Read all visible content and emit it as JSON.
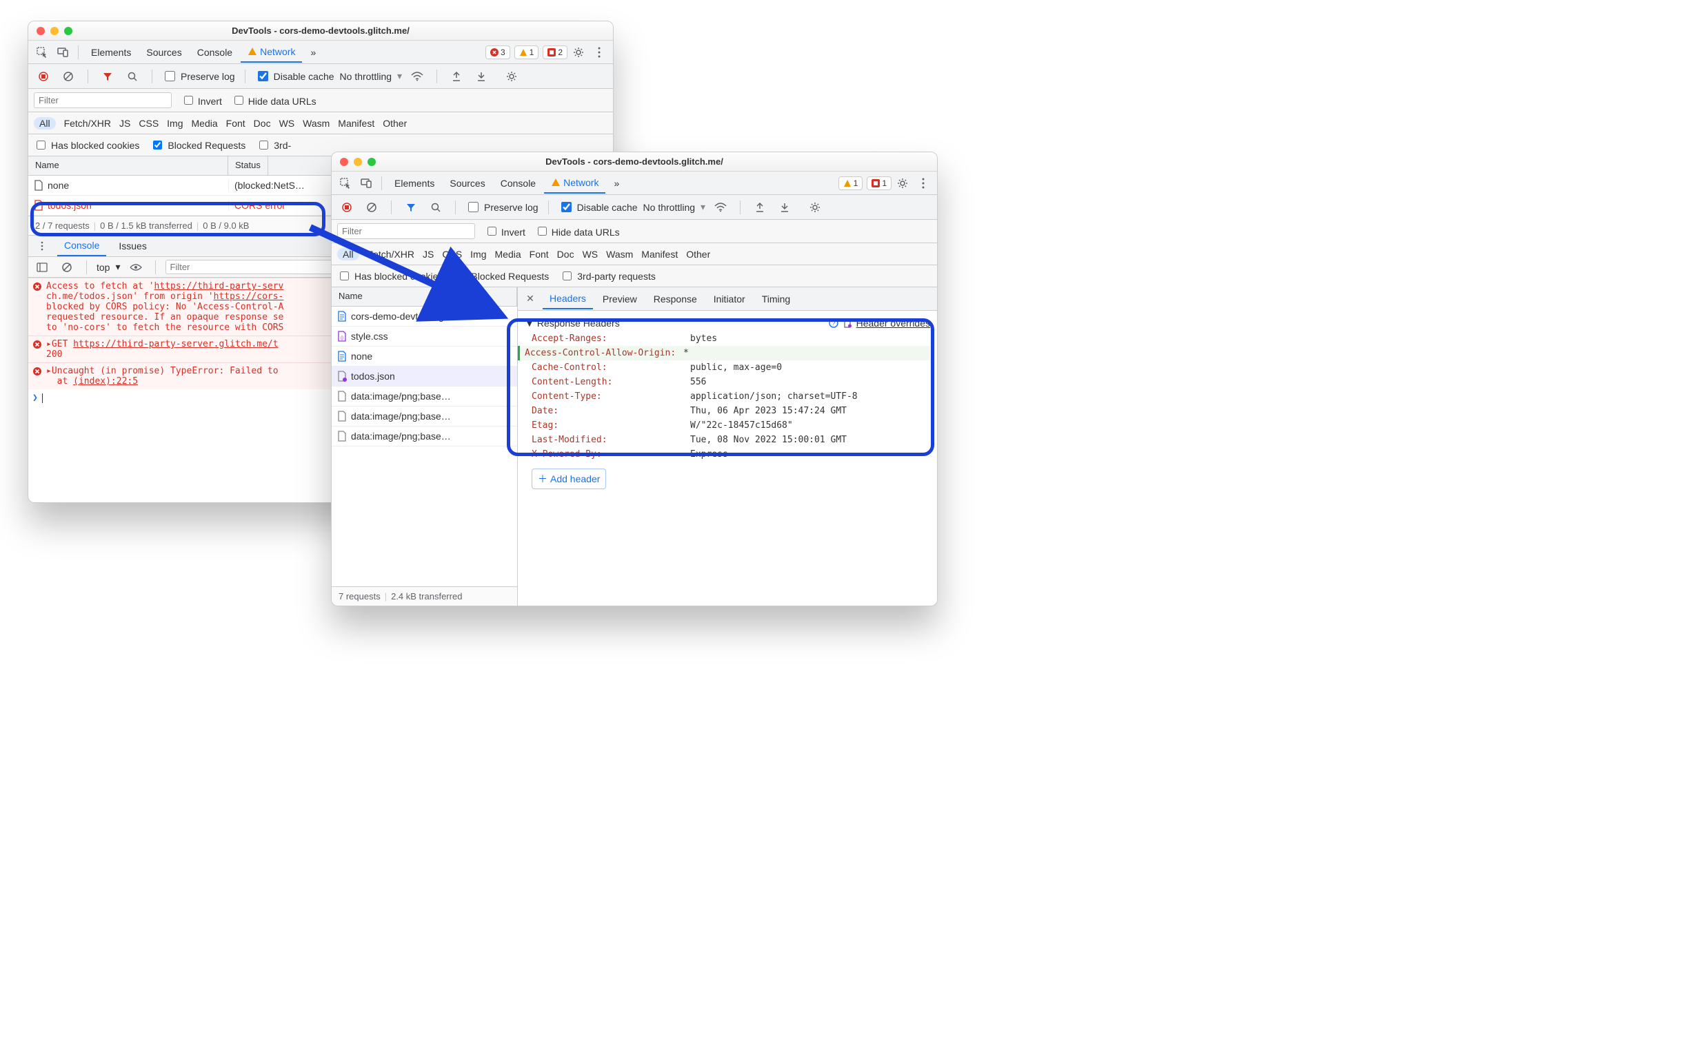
{
  "back": {
    "title": "DevTools - cors-demo-devtools.glitch.me/",
    "toptabs": {
      "elements": "Elements",
      "sources": "Sources",
      "console": "Console",
      "network": "Network",
      "more": "»"
    },
    "badges": {
      "errors": "3",
      "warnings": "1",
      "issues": "2"
    },
    "toolbar": {
      "preserve": "Preserve log",
      "disable": "Disable cache",
      "throttle": "No throttling"
    },
    "filter": {
      "placeholder": "Filter",
      "invert": "Invert",
      "hide": "Hide data URLs"
    },
    "chips": {
      "all": "All",
      "xhr": "Fetch/XHR",
      "js": "JS",
      "css": "CSS",
      "img": "Img",
      "media": "Media",
      "font": "Font",
      "doc": "Doc",
      "ws": "WS",
      "wasm": "Wasm",
      "manifest": "Manifest",
      "other": "Other"
    },
    "opts": {
      "blocked_cookies": "Has blocked cookies",
      "blocked_req": "Blocked Requests",
      "third": "3rd-"
    },
    "cols": {
      "name": "Name",
      "status": "Status"
    },
    "rows": [
      {
        "name": "none",
        "status": "(blocked:NetS…",
        "cls": ""
      },
      {
        "name": "todos.json",
        "status": "CORS error",
        "cls": "err"
      }
    ],
    "footer": {
      "a": "2 / 7 requests",
      "b": "0 B / 1.5 kB transferred",
      "c": "0 B / 9.0 kB"
    },
    "drawer_tabs": {
      "console": "Console",
      "issues": "Issues"
    },
    "context": "top",
    "filter2": "Filter",
    "console": [
      "Access to fetch at 'https://third-party-serv\nch.me/todos.json' from origin 'https://cors-\nblocked by CORS policy: No 'Access-Control-A\nrequested resource. If an opaque response se\nto 'no-cors' to fetch the resource with CORS",
      "▸GET https://third-party-server.glitch.me/t\n200",
      "▸Uncaught (in promise) TypeError: Failed to\n  at (index):22:5"
    ]
  },
  "front": {
    "title": "DevTools - cors-demo-devtools.glitch.me/",
    "toptabs": {
      "elements": "Elements",
      "sources": "Sources",
      "console": "Console",
      "network": "Network",
      "more": "»"
    },
    "badges": {
      "warnings": "1",
      "issues": "1"
    },
    "toolbar": {
      "preserve": "Preserve log",
      "disable": "Disable cache",
      "throttle": "No throttling"
    },
    "filter": {
      "placeholder": "Filter",
      "invert": "Invert",
      "hide": "Hide data URLs"
    },
    "chips": {
      "all": "All",
      "xhr": "Fetch/XHR",
      "js": "JS",
      "css": "CSS",
      "img": "Img",
      "media": "Media",
      "font": "Font",
      "doc": "Doc",
      "ws": "WS",
      "wasm": "Wasm",
      "manifest": "Manifest",
      "other": "Other"
    },
    "opts": {
      "blocked_cookies": "Has blocked cookies",
      "blocked_req": "Blocked Requests",
      "third": "3rd-party requests"
    },
    "cols": {
      "name": "Name"
    },
    "files": [
      {
        "name": "cors-demo-devtools.glitch.me",
        "icon": "doc",
        "color": "#1a73e8"
      },
      {
        "name": "style.css",
        "icon": "css",
        "color": "#9334e6"
      },
      {
        "name": "none",
        "icon": "doc",
        "color": "#1a73e8"
      },
      {
        "name": "todos.json",
        "icon": "file",
        "sel": true,
        "color": "#888"
      },
      {
        "name": "data:image/png;base…",
        "icon": "file",
        "color": "#888"
      },
      {
        "name": "data:image/png;base…",
        "icon": "file",
        "color": "#888"
      },
      {
        "name": "data:image/png;base…",
        "icon": "file",
        "color": "#888"
      }
    ],
    "footer": {
      "a": "7 requests",
      "b": "2.4 kB transferred"
    },
    "detail_tabs": {
      "headers": "Headers",
      "preview": "Preview",
      "response": "Response",
      "initiator": "Initiator",
      "timing": "Timing"
    },
    "section": "Response Headers",
    "override": "Header overrides",
    "headers": [
      {
        "k": "Accept-Ranges:",
        "v": "bytes"
      },
      {
        "k": "Access-Control-Allow-Origin:",
        "v": "*",
        "edited": true
      },
      {
        "k": "Cache-Control:",
        "v": "public, max-age=0"
      },
      {
        "k": "Content-Length:",
        "v": "556"
      },
      {
        "k": "Content-Type:",
        "v": "application/json; charset=UTF-8"
      },
      {
        "k": "Date:",
        "v": "Thu, 06 Apr 2023 15:47:24 GMT"
      },
      {
        "k": "Etag:",
        "v": "W/\"22c-18457c15d68\""
      },
      {
        "k": "Last-Modified:",
        "v": "Tue, 08 Nov 2022 15:00:01 GMT"
      },
      {
        "k": "X-Powered-By:",
        "v": "Express"
      }
    ],
    "addheader": "Add header"
  }
}
